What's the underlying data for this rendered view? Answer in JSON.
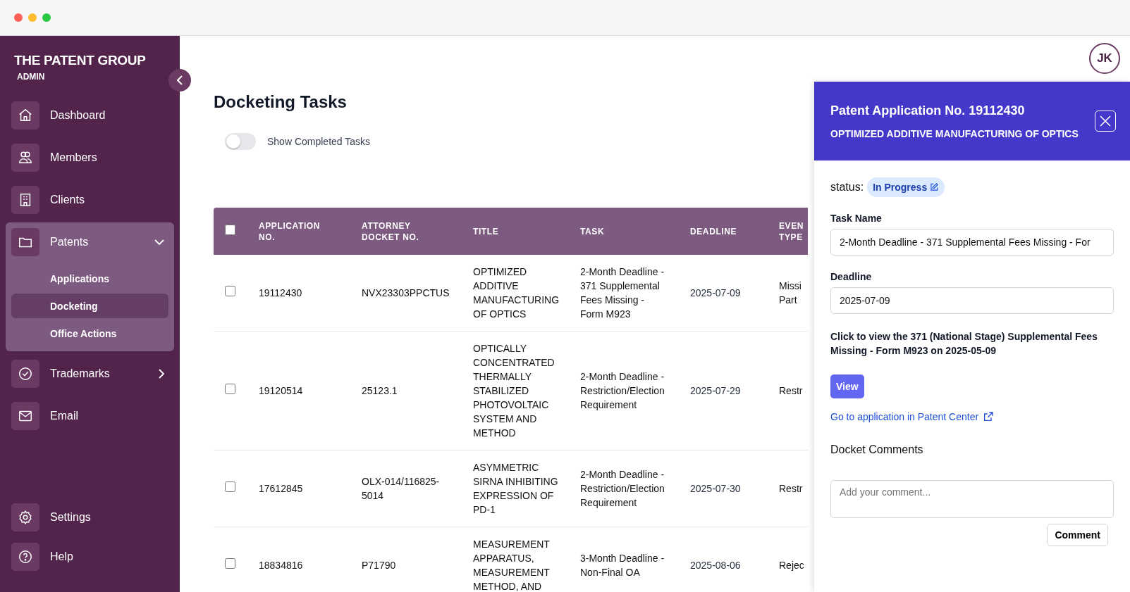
{
  "sidebar": {
    "brand": "THE PATENT GROUP",
    "role": "ADMIN",
    "items": [
      {
        "label": "Dashboard",
        "kind": "link",
        "selected": false
      },
      {
        "label": "Members",
        "kind": "link",
        "selected": false
      },
      {
        "label": "Clients",
        "kind": "link",
        "selected": false
      },
      {
        "label": "Patents",
        "kind": "group",
        "selected": false,
        "expanded": true,
        "children": [
          {
            "label": "Applications",
            "selected": false
          },
          {
            "label": "Docketing",
            "selected": true
          },
          {
            "label": "Office Actions",
            "selected": false
          }
        ]
      },
      {
        "label": "Trademarks",
        "kind": "group",
        "selected": false,
        "expanded": false
      },
      {
        "label": "Email",
        "kind": "link",
        "selected": false
      }
    ],
    "footer_items": [
      {
        "label": "Settings",
        "selected": false
      },
      {
        "label": "Help",
        "selected": false
      }
    ]
  },
  "user": {
    "initials": "JK"
  },
  "page": {
    "title": "Docketing Tasks",
    "toggle": {
      "label": "Show Completed Tasks",
      "on": false
    }
  },
  "table": {
    "all_selected": false,
    "columns": [
      "APPLICATION NO.",
      "ATTORNEY DOCKET NO.",
      "TITLE",
      "TASK",
      "DEADLINE",
      "EVEN TYPE"
    ],
    "rows": [
      {
        "selected": false,
        "cells": [
          "19112430",
          "NVX23303PPCTUS",
          "OPTIMIZED ADDITIVE MANUFACTURING OF OPTICS",
          "2-Month Deadline - 371 Supplemental Fees Missing - Form M923",
          "2025-07-09",
          "Missi Part"
        ]
      },
      {
        "selected": false,
        "cells": [
          "19120514",
          "25123.1",
          "OPTICALLY CONCENTRATED THERMALLY STABILIZED PHOTOVOLTAIC SYSTEM AND METHOD",
          "2-Month Deadline - Restriction/Election Requirement",
          "2025-07-29",
          "Restr"
        ]
      },
      {
        "selected": false,
        "cells": [
          "17612845",
          "OLX-014/116825-5014",
          "ASYMMETRIC SIRNA INHIBITING EXPRESSION OF PD-1",
          "2-Month Deadline - Restriction/Election Requirement",
          "2025-07-30",
          "Restr"
        ]
      },
      {
        "selected": false,
        "cells": [
          "18834816",
          "P71790",
          "MEASUREMENT APPARATUS, MEASUREMENT METHOD, AND",
          "3-Month Deadline - Non-Final OA",
          "2025-08-06",
          "Rejec"
        ]
      }
    ]
  },
  "panel": {
    "title": "Patent Application No. 19112430",
    "subtitle": "OPTIMIZED ADDITIVE MANUFACTURING OF OPTICS",
    "status_label": "status:",
    "status": "In Progress",
    "fields": [
      {
        "label": "Task Name",
        "value": "2-Month Deadline - 371 Supplemental Fees Missing - For"
      },
      {
        "label": "Deadline",
        "value": "2025-07-09"
      }
    ],
    "note": "Click to view the 371 (National Stage) Supplemental Fees Missing - Form M923 on 2025-05-09",
    "view_button": "View",
    "link": "Go to application in Patent Center",
    "comments_heading": "Docket Comments",
    "comment_placeholder": "Add your comment...",
    "comment_button": "Comment"
  }
}
